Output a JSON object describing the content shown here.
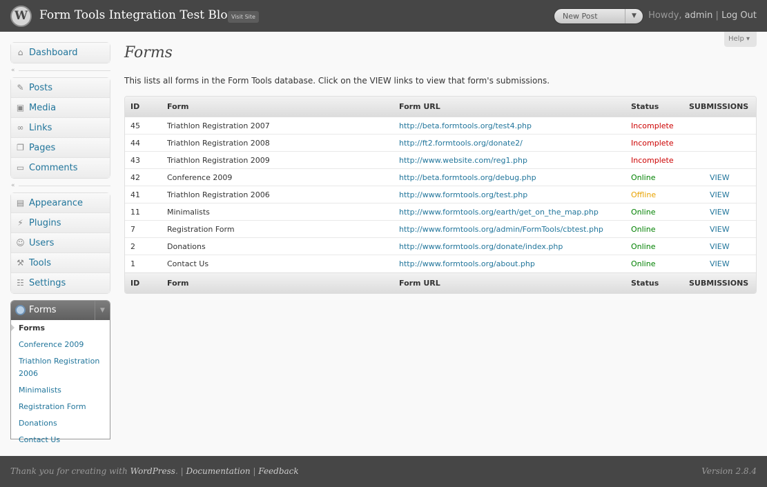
{
  "header": {
    "site_title": "Form Tools Integration Test Blog",
    "visit_site": "Visit Site",
    "new_post": "New Post",
    "howdy": "Howdy,",
    "user": "admin",
    "divider": "|",
    "logout": "Log Out",
    "logo_glyph": "W"
  },
  "help": {
    "label": "Help ▾"
  },
  "sidebar": {
    "dashboard": "Dashboard",
    "group2": [
      {
        "label": "Posts",
        "icon": "pin-icon",
        "glyph": "✎"
      },
      {
        "label": "Media",
        "icon": "media-icon",
        "glyph": "▣"
      },
      {
        "label": "Links",
        "icon": "link-icon",
        "glyph": "∞"
      },
      {
        "label": "Pages",
        "icon": "pages-icon",
        "glyph": "❐"
      },
      {
        "label": "Comments",
        "icon": "comments-icon",
        "glyph": "▭"
      }
    ],
    "group3": [
      {
        "label": "Appearance",
        "icon": "appearance-icon",
        "glyph": "▤"
      },
      {
        "label": "Plugins",
        "icon": "plugins-icon",
        "glyph": "⚡"
      },
      {
        "label": "Users",
        "icon": "users-icon",
        "glyph": "☺"
      },
      {
        "label": "Tools",
        "icon": "tools-icon",
        "glyph": "⚒"
      },
      {
        "label": "Settings",
        "icon": "settings-icon",
        "glyph": "☷"
      }
    ],
    "collapse_glyph": "«",
    "forms_menu": {
      "title": "Forms",
      "toggle": "▼",
      "items": [
        {
          "label": "Forms",
          "current": true
        },
        {
          "label": "Conference 2009"
        },
        {
          "label": "Triathlon Registration 2006"
        },
        {
          "label": "Minimalists"
        },
        {
          "label": "Registration Form"
        },
        {
          "label": "Donations"
        },
        {
          "label": "Contact Us"
        }
      ]
    }
  },
  "main": {
    "title": "Forms",
    "intro": "This lists all forms in the Form Tools database. Click on the VIEW links to view that form's submissions.",
    "columns": {
      "id": "ID",
      "form": "Form",
      "url": "Form URL",
      "status": "Status",
      "submissions": "SUBMISSIONS"
    },
    "rows": [
      {
        "id": "45",
        "form": "Triathlon Registration 2007",
        "url": "http://beta.formtools.org/test4.php",
        "status": "Incomplete",
        "view": ""
      },
      {
        "id": "44",
        "form": "Triathlon Registration 2008",
        "url": "http://ft2.formtools.org/donate2/",
        "status": "Incomplete",
        "view": ""
      },
      {
        "id": "43",
        "form": "Triathlon Registration 2009",
        "url": "http://www.website.com/reg1.php",
        "status": "Incomplete",
        "view": ""
      },
      {
        "id": "42",
        "form": "Conference 2009",
        "url": "http://beta.formtools.org/debug.php",
        "status": "Online",
        "view": "VIEW"
      },
      {
        "id": "41",
        "form": "Triathlon Registration 2006",
        "url": "http://www.formtools.org/test.php",
        "status": "Offline",
        "view": "VIEW"
      },
      {
        "id": "11",
        "form": "Minimalists",
        "url": "http://www.formtools.org/earth/get_on_the_map.php",
        "status": "Online",
        "view": "VIEW"
      },
      {
        "id": "7",
        "form": "Registration Form",
        "url": "http://www.formtools.org/admin/FormTools/cbtest.php",
        "status": "Online",
        "view": "VIEW"
      },
      {
        "id": "2",
        "form": "Donations",
        "url": "http://www.formtools.org/donate/index.php",
        "status": "Online",
        "view": "VIEW"
      },
      {
        "id": "1",
        "form": "Contact Us",
        "url": "http://www.formtools.org/about.php",
        "status": "Online",
        "view": "VIEW"
      }
    ],
    "status_colors": {
      "Incomplete": "#cc0000",
      "Online": "#008000",
      "Offline": "#e8a200"
    }
  },
  "footer": {
    "thanks": "Thank you for creating with",
    "wordpress": "WordPress",
    "period": ".",
    "sep": "|",
    "documentation": "Documentation",
    "feedback": "Feedback",
    "version": "Version 2.8.4"
  }
}
